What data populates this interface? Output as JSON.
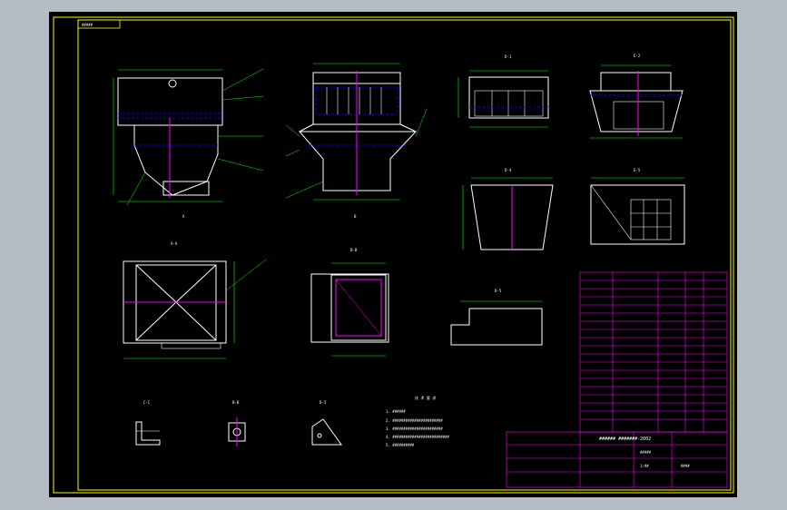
{
  "drawing": {
    "corner_label": "#####",
    "colors": {
      "background": "#000000",
      "border": "#ffff00",
      "outline": "#ffffff",
      "dimension": "#00ff00",
      "centerline": "#ff00ff",
      "hidden": "#0000ff",
      "table": "#ff00ff"
    },
    "views": [
      {
        "id": "front",
        "label": "A"
      },
      {
        "id": "side",
        "label": "B"
      },
      {
        "id": "top-right-1",
        "label": "D-1"
      },
      {
        "id": "top-right-2",
        "label": "E-2"
      },
      {
        "id": "hopper-1",
        "label": "D-4"
      },
      {
        "id": "hopper-2",
        "label": "E-5"
      },
      {
        "id": "bottom-a",
        "label": "A-A"
      },
      {
        "id": "bottom-b",
        "label": "B-B"
      },
      {
        "id": "step",
        "label": "D-5"
      },
      {
        "id": "detail-c",
        "label": "C-C"
      },
      {
        "id": "detail-b",
        "label": "B-B"
      },
      {
        "id": "detail-d",
        "label": "D-5"
      }
    ],
    "notes_title": "技 术 要 求",
    "notes": [
      "1. ######",
      "2. #######################",
      "3. #######################",
      "4. ##########################",
      "5. ##########"
    ],
    "title_block": {
      "title": "######  #######-2002",
      "drawing_no": "#####",
      "scale": "1:##",
      "sheet": "####"
    }
  }
}
